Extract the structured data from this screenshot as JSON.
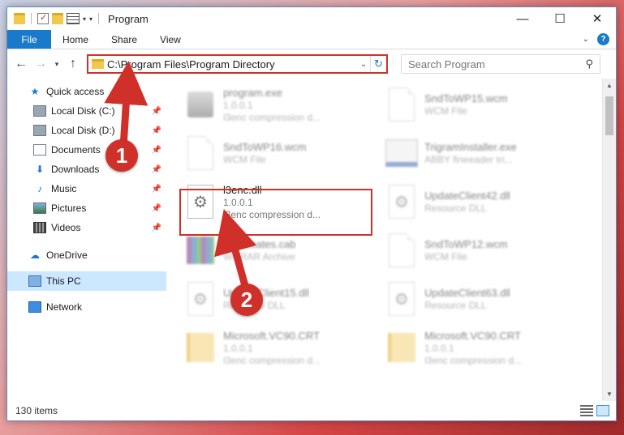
{
  "window": {
    "title": "Program",
    "controls": {
      "minimize": "—",
      "maximize": "☐",
      "close": "✕"
    }
  },
  "ribbon": {
    "file_tab": "File",
    "tabs": [
      "Home",
      "Share",
      "View"
    ]
  },
  "address": {
    "path": "C:\\Program Files\\Program Directory"
  },
  "search": {
    "placeholder": "Search Program"
  },
  "navigation": {
    "quick_access": "Quick access",
    "items": [
      {
        "label": "Local Disk (C:)",
        "icon": "disk-icon"
      },
      {
        "label": "Local Disk (D:)",
        "icon": "disk-icon"
      },
      {
        "label": "Documents",
        "icon": "documents-icon"
      },
      {
        "label": "Downloads",
        "icon": "downloads-icon"
      },
      {
        "label": "Music",
        "icon": "music-icon"
      },
      {
        "label": "Pictures",
        "icon": "pictures-icon"
      },
      {
        "label": "Videos",
        "icon": "videos-icon"
      }
    ],
    "onedrive": "OneDrive",
    "this_pc": "This PC",
    "network": "Network"
  },
  "files": [
    {
      "name": "program.exe",
      "line2": "1.0.0.1",
      "line3": "l3enc compression d..."
    },
    {
      "name": "SndToWP15.wcm",
      "line2": "WCM File",
      "line3": ""
    },
    {
      "name": "SndToWP16.wcm",
      "line2": "WCM File",
      "line3": ""
    },
    {
      "name": "TrigramInstaller.exe",
      "line2": "ABBY fineeader tri...",
      "line3": ""
    },
    {
      "name": "l3enc.dll",
      "line2": "1.0.0.1",
      "line3": "l3enc compression d..."
    },
    {
      "name": "UpdateClient42.dll",
      "line2": "Resource DLL",
      "line3": ""
    },
    {
      "name": "Certificates.cab",
      "line2": "WinRAR Archive",
      "line3": ""
    },
    {
      "name": "SndToWP12.wcm",
      "line2": "WCM File",
      "line3": ""
    },
    {
      "name": "UpdateClient15.dll",
      "line2": "Resource DLL",
      "line3": ""
    },
    {
      "name": "UpdateClient63.dll",
      "line2": "Resource DLL",
      "line3": ""
    },
    {
      "name": "Microsoft.VC90.CRT",
      "line2": "1.0.0.1",
      "line3": "l3enc compression d..."
    },
    {
      "name": "Microsoft.VC90.CRT",
      "line2": "1.0.0.1",
      "line3": "l3enc compression d..."
    }
  ],
  "status": {
    "item_count": "130 items"
  },
  "annotations": {
    "step1": "1",
    "step2": "2",
    "accent_color": "#d0302a"
  }
}
